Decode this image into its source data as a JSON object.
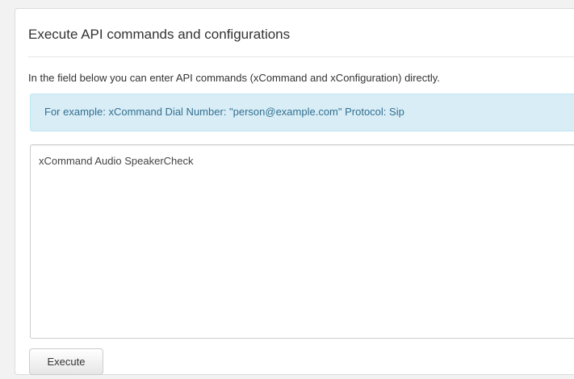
{
  "panel": {
    "title": "Execute API commands and configurations",
    "description": "In the field below you can enter API commands (xCommand and xConfiguration) directly.",
    "example": "For example: xCommand Dial Number: \"person@example.com\" Protocol: Sip",
    "command_value": "xCommand Audio SpeakerCheck",
    "execute_label": "Execute"
  },
  "colors": {
    "alert_background": "#d9edf7",
    "alert_text": "#31708f",
    "page_background": "#f2f2f2"
  }
}
